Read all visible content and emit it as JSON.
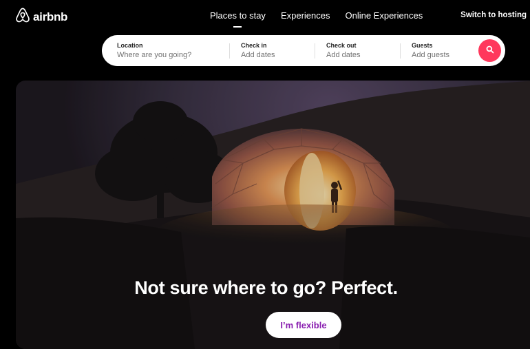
{
  "brand": {
    "name": "airbnb",
    "color": "#ff385c"
  },
  "nav": {
    "items": [
      {
        "label": "Places to stay",
        "active": true
      },
      {
        "label": "Experiences",
        "active": false
      },
      {
        "label": "Online Experiences",
        "active": false
      }
    ],
    "host_link": "Switch to hosting"
  },
  "search": {
    "location": {
      "label": "Location",
      "placeholder": "Where are you going?"
    },
    "check_in": {
      "label": "Check in",
      "placeholder": "Add dates"
    },
    "check_out": {
      "label": "Check out",
      "placeholder": "Add dates"
    },
    "guests": {
      "label": "Guests",
      "placeholder": "Add guests"
    },
    "button_icon": "search-icon"
  },
  "hero": {
    "title": "Not sure where to go? Perfect.",
    "button_label": "I’m flexible",
    "button_color": "#8a1fb0"
  }
}
